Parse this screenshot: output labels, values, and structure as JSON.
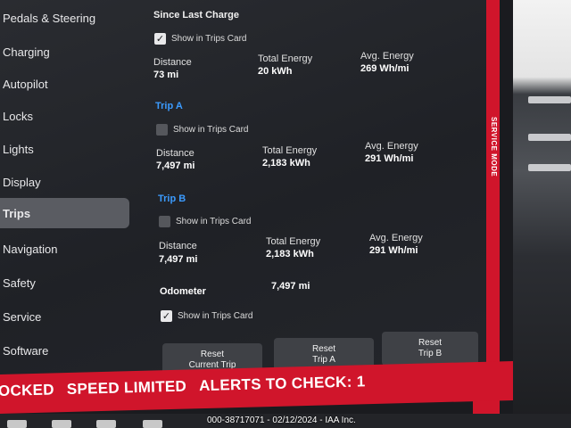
{
  "sidebar": {
    "items": [
      {
        "label": "Pedals & Steering",
        "active": false
      },
      {
        "label": "Charging",
        "active": false
      },
      {
        "label": "Autopilot",
        "active": false
      },
      {
        "label": "Locks",
        "active": false
      },
      {
        "label": "Lights",
        "active": false
      },
      {
        "label": "Display",
        "active": false
      },
      {
        "label": "Trips",
        "active": true
      },
      {
        "label": "Navigation",
        "active": false
      },
      {
        "label": "Safety",
        "active": false
      },
      {
        "label": "Service",
        "active": false
      },
      {
        "label": "Software",
        "active": false
      }
    ]
  },
  "since_last_charge": {
    "title": "Since Last Charge",
    "show_in_trips_card": {
      "label": "Show in Trips Card",
      "checked": true
    },
    "distance": {
      "label": "Distance",
      "value": "73 mi"
    },
    "total_energy": {
      "label": "Total Energy",
      "value": "20 kWh"
    },
    "avg_energy": {
      "label": "Avg. Energy",
      "value": "269 Wh/mi"
    }
  },
  "trip_a": {
    "title": "Trip A",
    "show_in_trips_card": {
      "label": "Show in Trips Card",
      "checked": false
    },
    "distance": {
      "label": "Distance",
      "value": "7,497 mi"
    },
    "total_energy": {
      "label": "Total Energy",
      "value": "2,183 kWh"
    },
    "avg_energy": {
      "label": "Avg. Energy",
      "value": "291 Wh/mi"
    }
  },
  "trip_b": {
    "title": "Trip B",
    "show_in_trips_card": {
      "label": "Show in Trips Card",
      "checked": false
    },
    "distance": {
      "label": "Distance",
      "value": "7,497 mi"
    },
    "total_energy": {
      "label": "Total Energy",
      "value": "2,183 kWh"
    },
    "avg_energy": {
      "label": "Avg. Energy",
      "value": "291 Wh/mi"
    }
  },
  "odometer": {
    "label": "Odometer",
    "value": "7,497 mi",
    "show_in_trips_card": {
      "label": "Show in Trips Card",
      "checked": true
    }
  },
  "buttons": {
    "reset_current_trip": "Reset\nCurrent Trip",
    "reset_trip_a": "Reset\nTrip A",
    "reset_trip_b": "Reset\nTrip B"
  },
  "banner": {
    "locked": "OCKED",
    "speed_limited": "SPEED LIMITED",
    "alerts": "ALERTS TO CHECK: 1"
  },
  "service_mode": "SERVICE MODE",
  "watermark": "000-38717071 - 02/12/2024 - IAA Inc.",
  "colors": {
    "service_red": "#d0152b",
    "trip_title_blue": "#3b9bff",
    "active_item": "#5a5c62"
  }
}
